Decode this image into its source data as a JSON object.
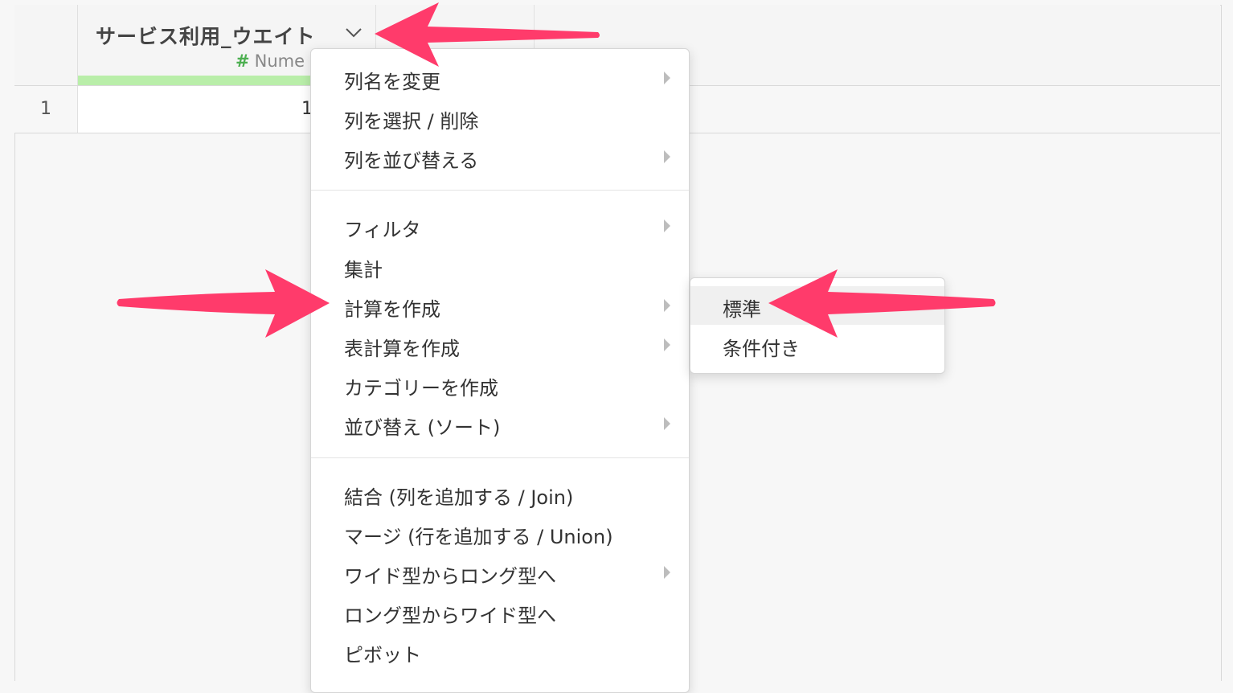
{
  "grid": {
    "column": {
      "name": "サービス利用_ウエイト",
      "type_label": "Nume",
      "type_icon": "hash-icon"
    },
    "rows": [
      {
        "rownum": "1",
        "value": "1"
      }
    ]
  },
  "menu": {
    "groups": [
      [
        {
          "label": "列名を変更",
          "has_submenu": true
        },
        {
          "label": "列を選択 / 削除",
          "has_submenu": false
        },
        {
          "label": "列を並び替える",
          "has_submenu": true
        }
      ],
      [
        {
          "label": "フィルタ",
          "has_submenu": true
        },
        {
          "label": "集計",
          "has_submenu": false
        },
        {
          "label": "計算を作成",
          "has_submenu": true
        },
        {
          "label": "表計算を作成",
          "has_submenu": true
        },
        {
          "label": "カテゴリーを作成",
          "has_submenu": false
        },
        {
          "label": "並び替え (ソート)",
          "has_submenu": true
        }
      ],
      [
        {
          "label": "結合 (列を追加する / Join)",
          "has_submenu": false
        },
        {
          "label": "マージ (行を追加する / Union)",
          "has_submenu": false
        },
        {
          "label": "ワイド型からロング型へ",
          "has_submenu": true
        },
        {
          "label": "ロング型からワイド型へ",
          "has_submenu": false
        },
        {
          "label": "ピボット",
          "has_submenu": false
        }
      ]
    ]
  },
  "submenu": {
    "items": [
      {
        "label": "標準",
        "hovered": true
      },
      {
        "label": "条件付き",
        "hovered": false
      }
    ]
  },
  "colors": {
    "annotation_arrow": "#ff3b6b",
    "quality_bar": "#b9eea9",
    "type_hash": "#4caf50"
  }
}
